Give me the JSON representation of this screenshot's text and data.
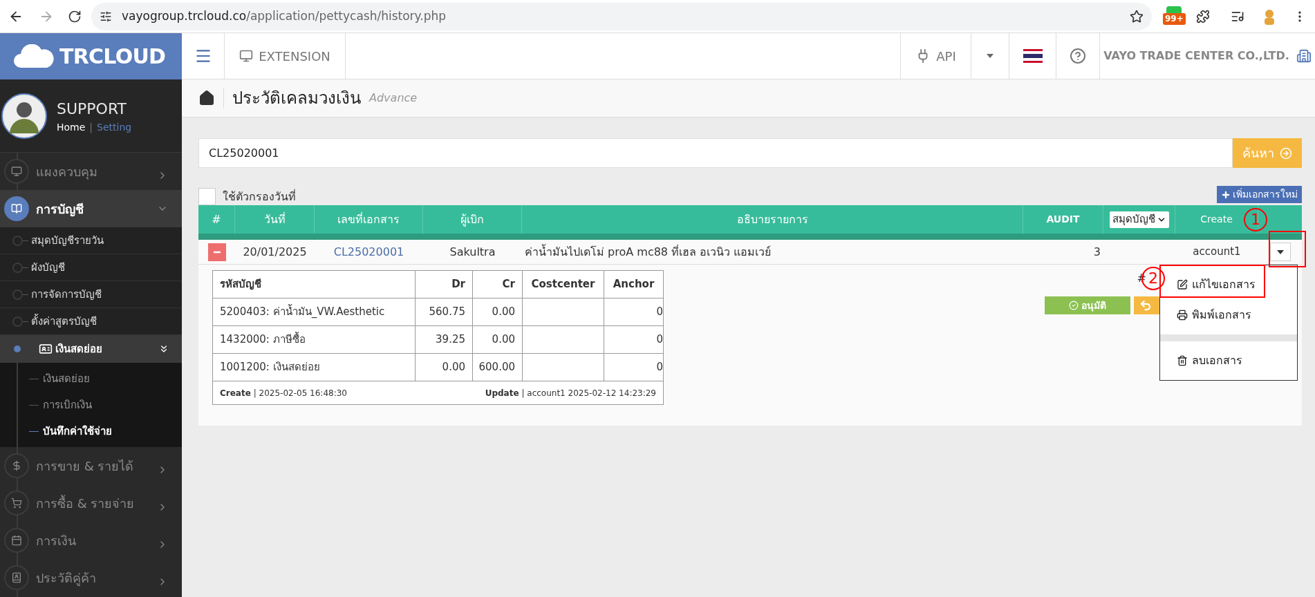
{
  "browser": {
    "url_host": "vayogroup.trcloud.co",
    "url_path": "/application/pettycash/history.php",
    "badge": "99+"
  },
  "header": {
    "logo": "TRCLOUD",
    "extension": "EXTENSION",
    "api": "API",
    "company": "VAYO TRADE CENTER CO.,LTD."
  },
  "user": {
    "name": "SUPPORT",
    "separator": "|",
    "links": [
      {
        "label": "Home",
        "selected": true
      },
      {
        "label": "Setting",
        "selected": false
      }
    ]
  },
  "sidebar": {
    "items": [
      {
        "label": "แผงควบคุม",
        "expanded": false
      },
      {
        "label": "การบัญชี",
        "expanded": true,
        "children": [
          {
            "label": "สมุดบัญชีรายวัน",
            "expanded": false
          },
          {
            "label": "ผังบัญชี",
            "expanded": false
          },
          {
            "label": "การจัดการบัญชี",
            "expanded": false
          },
          {
            "label": "ตั้งค่าสูตรบัญชี",
            "expanded": false
          },
          {
            "label": "เงินสดย่อย",
            "expanded": true,
            "children": [
              {
                "label": "เงินสดย่อย",
                "selected": false
              },
              {
                "label": "การเบิกเงิน",
                "selected": false
              },
              {
                "label": "บันทึกค่าใช้จ่าย",
                "selected": true
              }
            ]
          }
        ]
      },
      {
        "label": "การขาย & รายได้",
        "expanded": false
      },
      {
        "label": "การซื้อ & รายจ่าย",
        "expanded": false
      },
      {
        "label": "การเงิน",
        "expanded": false
      },
      {
        "label": "ประวัติคู่ค้า",
        "expanded": false
      }
    ]
  },
  "page": {
    "title": "ประวัติเคลมวงเงิน",
    "subtitle": "Advance"
  },
  "search": {
    "value": "CL25020001",
    "button": "ค้นหา"
  },
  "date_filter": {
    "label": "ใช้ตัวกรองวันที่",
    "checked": false
  },
  "add_button": "เพิ่มเอกสารใหม่",
  "table": {
    "columns": [
      {
        "label": "#",
        "kind": "text"
      },
      {
        "label": "วันที่",
        "kind": "text"
      },
      {
        "label": "เลขที่เอกสาร",
        "kind": "text"
      },
      {
        "label": "ผู้เบิก",
        "kind": "text"
      },
      {
        "label": "อธิบายรายการ",
        "kind": "text"
      },
      {
        "label": "AUDIT",
        "kind": "bold"
      },
      {
        "label": "สมุดบัญชี",
        "kind": "select"
      },
      {
        "label": "Create",
        "kind": "text"
      }
    ],
    "rows": [
      {
        "expanded": true,
        "date": "20/01/2025",
        "doc_no": "CL25020001",
        "requester": "Sakultra",
        "description": "ค่าน้ำมันไปเดโม่ proA mc88 ที่เฮล อเวนิว แอมเวย์",
        "audit": "3",
        "create": "account1",
        "detail": {
          "columns": [
            "รหัสบัญชี",
            "Dr",
            "Cr",
            "Costcenter",
            "Anchor"
          ],
          "rows": [
            [
              "5200403: ค่าน้ำมัน_VW.Aesthetic",
              "560.75",
              "0.00",
              "",
              "0"
            ],
            [
              "1432000: ภาษีซื้อ",
              "39.25",
              "0.00",
              "",
              "0"
            ],
            [
              "1001200: เงินสดย่อย",
              "0.00",
              "600.00",
              "",
              "0"
            ]
          ],
          "separator": "|",
          "create_label": "Create",
          "create_value": "2025-02-05 16:48:30",
          "update_label": "Update",
          "update_value": "account1 2025-02-12 14:23:29"
        },
        "doc_ref": "#",
        "approve": "อนุมัติ"
      }
    ]
  },
  "menu": {
    "items": [
      {
        "label": "แก้ไขเอกสาร",
        "kind": "edit"
      },
      {
        "label": "พิมพ์เอกสาร",
        "kind": "print"
      },
      {
        "label": "ลบเอกสาร",
        "kind": "delete"
      }
    ]
  },
  "annotations": [
    {
      "label": "1"
    },
    {
      "label": "2"
    }
  ]
}
